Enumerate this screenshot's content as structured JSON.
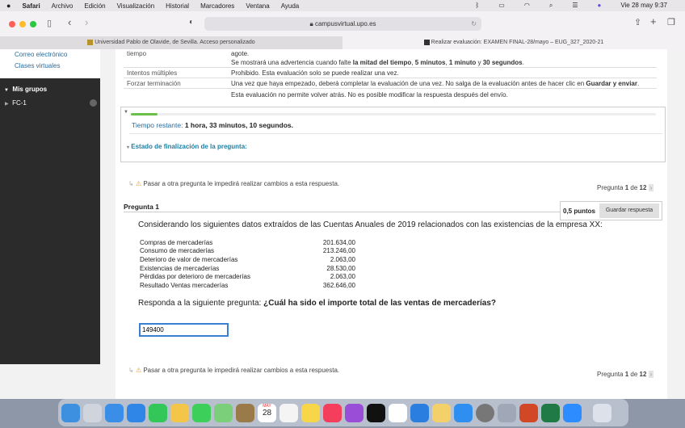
{
  "menubar": {
    "app": "Safari",
    "items": [
      "Archivo",
      "Edición",
      "Visualización",
      "Historial",
      "Marcadores",
      "Ventana",
      "Ayuda"
    ],
    "clock": "Vie 28 may  9:37"
  },
  "browser": {
    "url": "campusvirtual.upo.es",
    "tabs": [
      {
        "label": "Universidad Pablo de Olavide, de Sevilla. Acceso personalizado"
      },
      {
        "label": "Realizar evaluación: EXAMEN FINAL-28/mayo – EUG_327_2020-21"
      }
    ]
  },
  "sidebar": {
    "links": [
      "Correo electrónico",
      "Clases virtuales"
    ],
    "section": "Mis grupos",
    "groups": [
      "FC-1"
    ]
  },
  "info": {
    "rows": [
      {
        "label": "tiempo",
        "lines": [
          "agote.",
          "Se mostrará una advertencia cuando falte la mitad del tiempo, 5 minutos, 1 minuto y 30 segundos."
        ]
      },
      {
        "label": "Intentos múltiples",
        "lines": [
          "Prohibido. Esta evaluación solo se puede realizar una vez."
        ]
      },
      {
        "label": "Forzar terminación",
        "lines": [
          "Una vez que haya empezado, deberá completar la evaluación de una vez. No salga de la evaluación antes de hacer clic en Guardar y enviar.",
          "Esta evaluación no permite volver atrás. No es posible modificar la respuesta después del envío."
        ]
      }
    ]
  },
  "timer": {
    "label": "Tiempo restante:",
    "value": "1 hora, 33 minutos, 10 segundos.",
    "progress": 0.05,
    "status_label": "Estado de finalización de la pregunta:"
  },
  "nav": {
    "warning": "Pasar a otra pregunta le impedirá realizar cambios a esta respuesta.",
    "pregunta": "Pregunta",
    "current": "1",
    "of": "de",
    "total": "12"
  },
  "question": {
    "title": "Pregunta 1",
    "points": "0,5 puntos",
    "save_label": "Guardar respuesta",
    "intro": "Considerando los siguientes datos extraídos de las Cuentas Anuales de 2019 relacionados con las existencias de la empresa XX:",
    "data": [
      [
        "Compras de mercaderías",
        "201.634,00"
      ],
      [
        "Consumo de mercaderías",
        "213.246,00"
      ],
      [
        "Deterioro de valor de mercaderías",
        "2.063,00"
      ],
      [
        "Existencias de mercaderías",
        "28.530,00"
      ],
      [
        "Pérdidas por deterioro de mercaderías",
        "2.063,00"
      ],
      [
        "Resultado Ventas mercaderías",
        "362.646,00"
      ]
    ],
    "prompt": "Responda a la siguiente pregunta:",
    "prompt_bold": "¿Cuál ha sido el importe total de las ventas de mercaderías?",
    "answer": "149400"
  },
  "dock": {
    "calendar_month": "MAY",
    "calendar_day": "28"
  }
}
